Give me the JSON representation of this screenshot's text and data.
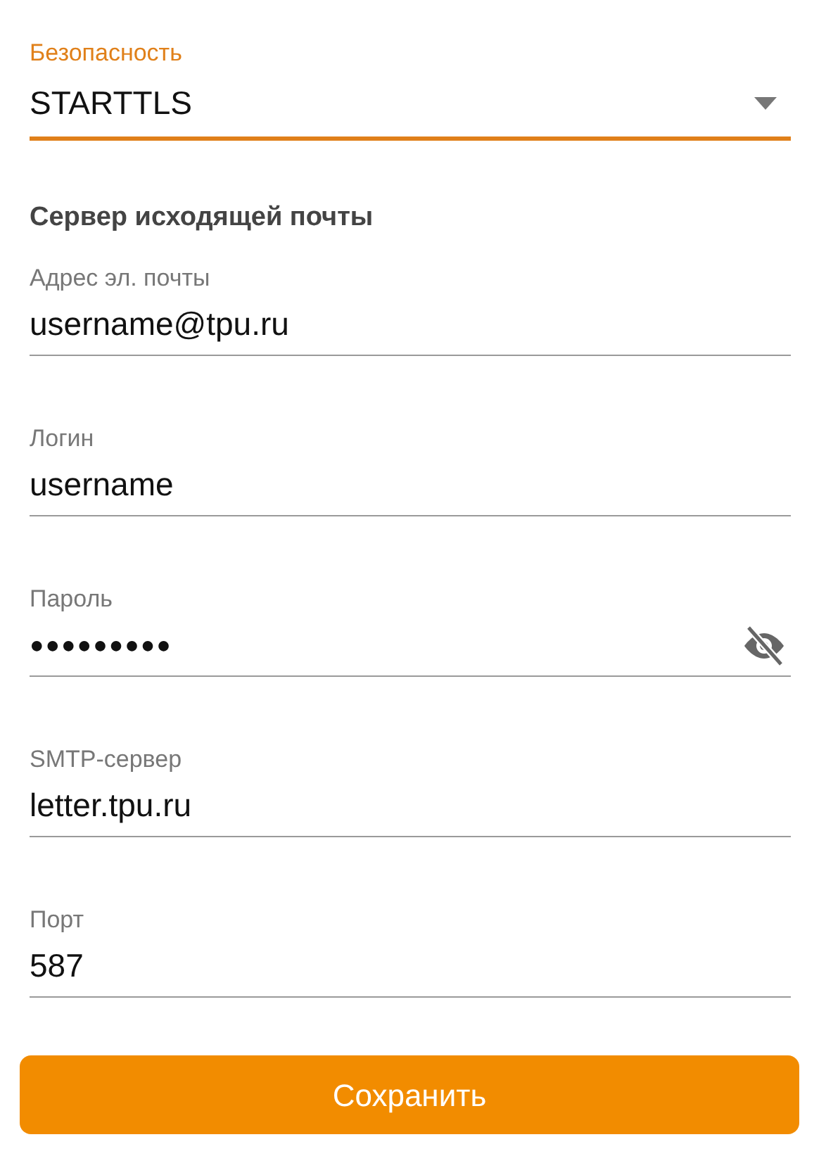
{
  "security": {
    "label": "Безопасность",
    "value": "STARTTLS",
    "focused": true
  },
  "section_title": "Сервер исходящей почты",
  "fields": [
    {
      "kind": "text",
      "label": "Адрес эл. почты",
      "value": "username@tpu.ru"
    },
    {
      "kind": "text",
      "label": "Логин",
      "value": "username"
    },
    {
      "kind": "password",
      "label": "Пароль",
      "value": "●●●●●●●●●"
    },
    {
      "kind": "text",
      "label": "SMTP-сервер",
      "value": "letter.tpu.ru"
    },
    {
      "kind": "text",
      "label": "Порт",
      "value": "587"
    }
  ],
  "save_button": "Сохранить"
}
